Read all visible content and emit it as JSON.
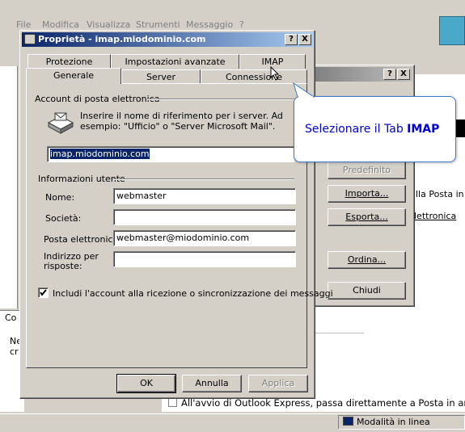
{
  "menubar": {
    "items": [
      "File",
      "Modifica",
      "Visualizza",
      "Strumenti",
      "Messaggio",
      "?"
    ]
  },
  "dialog": {
    "title": "Proprietà - imap.miodominio.com",
    "help_btn": "?",
    "close_btn": "X",
    "tabs_row1": [
      "Protezione",
      "Impostazioni avanzate",
      "IMAP"
    ],
    "tabs_row2": [
      "Generale",
      "Server",
      "Connessione"
    ],
    "account_group": "Account di posta elettronica",
    "account_hint": "Inserire il nome di riferimento per i server. Ad esempio: \"Ufficio\" o \"Server Microsoft Mail\".",
    "account_name": "imap.miodominio.com",
    "user_group": "Informazioni utente",
    "fields": {
      "nome_label": "Nome:",
      "nome_value": "webmaster",
      "societa_label": "Società:",
      "societa_value": "",
      "posta_label": "Posta elettronica:",
      "posta_value": "webmaster@miodominio.com",
      "risposte_label": "Indirizzo per risposte:",
      "risposte_value": ""
    },
    "include_checkbox": "Includi l'account alla ricezione o sincronizzazione dei messaggi",
    "ok": "OK",
    "cancel": "Annulla",
    "apply": "Applica"
  },
  "accounts_window": {
    "help_btn": "?",
    "close_btn": "X",
    "buttons": [
      "Predefinito",
      "Importa...",
      "Esporta...",
      "Ordina...",
      "Chiudi"
    ]
  },
  "callout": {
    "text_prefix": "Selezionare il Tab ",
    "text_bold": "IMAP"
  },
  "background": {
    "link_text1": "lla Posta in",
    "link_text2": "lettronica",
    "left_snippet1": "Co",
    "left_snippet2": "Ne",
    "left_snippet3": "cr",
    "bottom_text": "All'avvio di Outlook Express, passa direttamente a Posta in ar",
    "status": "Modalità in linea"
  },
  "colors": {
    "title_active": "#0a246a",
    "callout_text": "#0000cc",
    "callout_border": "#3c78c8"
  }
}
